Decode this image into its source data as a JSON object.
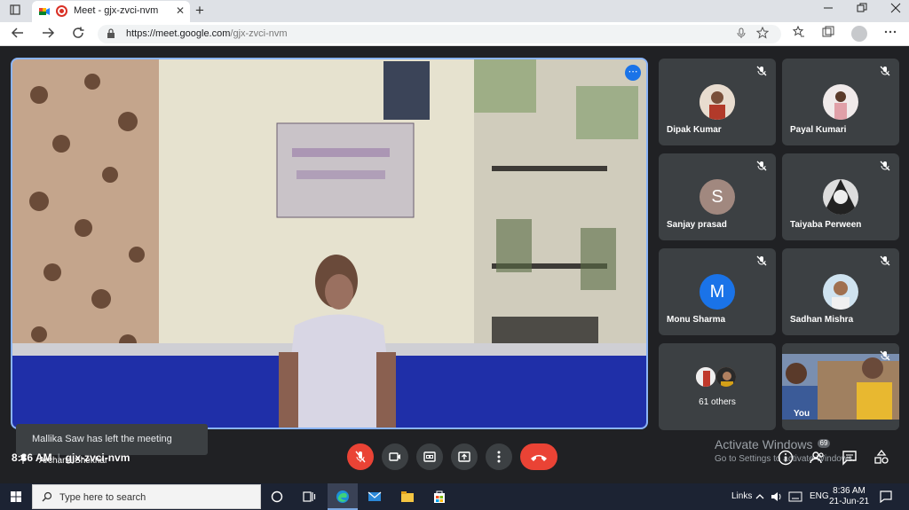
{
  "browser": {
    "tab_title": "Meet - gjx-zvci-nvm",
    "tab_close": "✕",
    "new_tab": "+",
    "url_domain": "https://meet.google.com",
    "url_path": "/gjx-zvci-nvm"
  },
  "main_video": {
    "speaker_name": "Archana Shekhar",
    "toast": "Mallika Saw has left the meeting",
    "more_icon": "⋯"
  },
  "participants": [
    {
      "name": "Dipak Kumar",
      "initial": "",
      "avatar_color": "#8b6b55"
    },
    {
      "name": "Payal Kumari",
      "initial": "",
      "avatar_color": "#b99a86"
    },
    {
      "name": "Sanjay prasad",
      "initial": "S",
      "avatar_color": "#a1887f"
    },
    {
      "name": "Taiyaba Perween",
      "initial": "",
      "avatar_color": "#444a55"
    },
    {
      "name": "Monu Sharma",
      "initial": "M",
      "avatar_color": "#1a73e8"
    },
    {
      "name": "Sadhan Mishra",
      "initial": "",
      "avatar_color": "#c49a7a"
    }
  ],
  "others": {
    "label": "61 others"
  },
  "self_tile": {
    "label": "You"
  },
  "meeting": {
    "time": "8:36 AM",
    "separator": "|",
    "code": "gjx-zvci-nvm"
  },
  "activate": {
    "line1": "Activate Windows",
    "line2": "Go to Settings to activate Windows."
  },
  "people_badge": "69",
  "taskbar": {
    "search_placeholder": "Type here to search",
    "links": "Links",
    "lang": "ENG",
    "time": "8:36 AM",
    "date": "21-Jun-21"
  },
  "colors": {
    "accent": "#8ab4f8",
    "danger": "#ea4335",
    "tile_bg": "#3c4043",
    "bg": "#202124"
  }
}
